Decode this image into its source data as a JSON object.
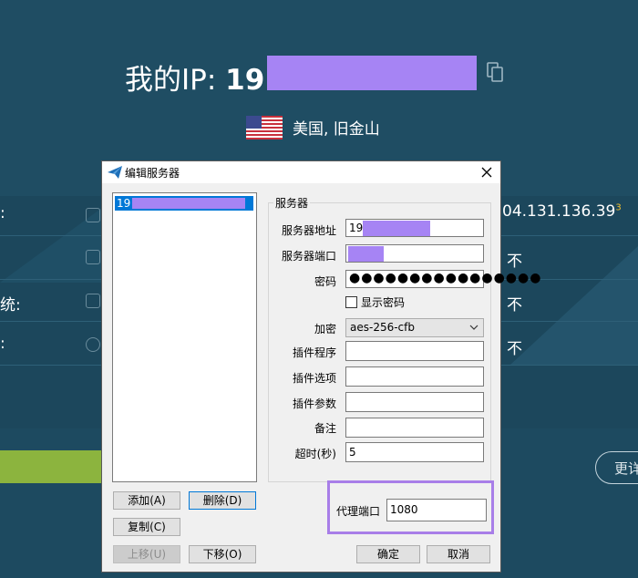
{
  "background": {
    "ip_label": "我的IP: ",
    "ip_prefix": "19",
    "location": "美国, 旧金山",
    "row1_left": ":",
    "row1_right": "04.131.136.39",
    "row1_sup": "3",
    "row2_right": "不",
    "row3_left": "统:",
    "row3_right": "不",
    "row4_left": ":",
    "row4_right": "不",
    "more_button": "更详"
  },
  "dialog": {
    "title": "编辑服务器",
    "list": [
      {
        "label": "19"
      }
    ],
    "group_title": "服务器",
    "fields": {
      "server_address": {
        "label": "服务器地址",
        "value": "19"
      },
      "server_port": {
        "label": "服务器端口",
        "value": ""
      },
      "password": {
        "label": "密码",
        "value": "●●●●●●●●●●●●●●●●"
      },
      "show_password": {
        "label": "显示密码",
        "checked": false
      },
      "encryption": {
        "label": "加密",
        "value": "aes-256-cfb"
      },
      "plugin_program": {
        "label": "插件程序",
        "value": ""
      },
      "plugin_options": {
        "label": "插件选项",
        "value": ""
      },
      "plugin_args": {
        "label": "插件参数",
        "value": ""
      },
      "remarks": {
        "label": "备注",
        "value": ""
      },
      "timeout": {
        "label": "超时(秒)",
        "value": "5"
      }
    },
    "proxy_port": {
      "label": "代理端口",
      "value": "1080"
    },
    "buttons": {
      "add": "添加(A)",
      "delete": "删除(D)",
      "copy": "复制(C)",
      "move_up": "上移(U)",
      "move_down": "下移(O)",
      "ok": "确定",
      "cancel": "取消"
    }
  },
  "colors": {
    "background": "#1f4d63",
    "redaction": "#a684f4",
    "highlight_frame": "#a87ee8",
    "accent": "#8cb43e",
    "selection": "#0078d7"
  }
}
